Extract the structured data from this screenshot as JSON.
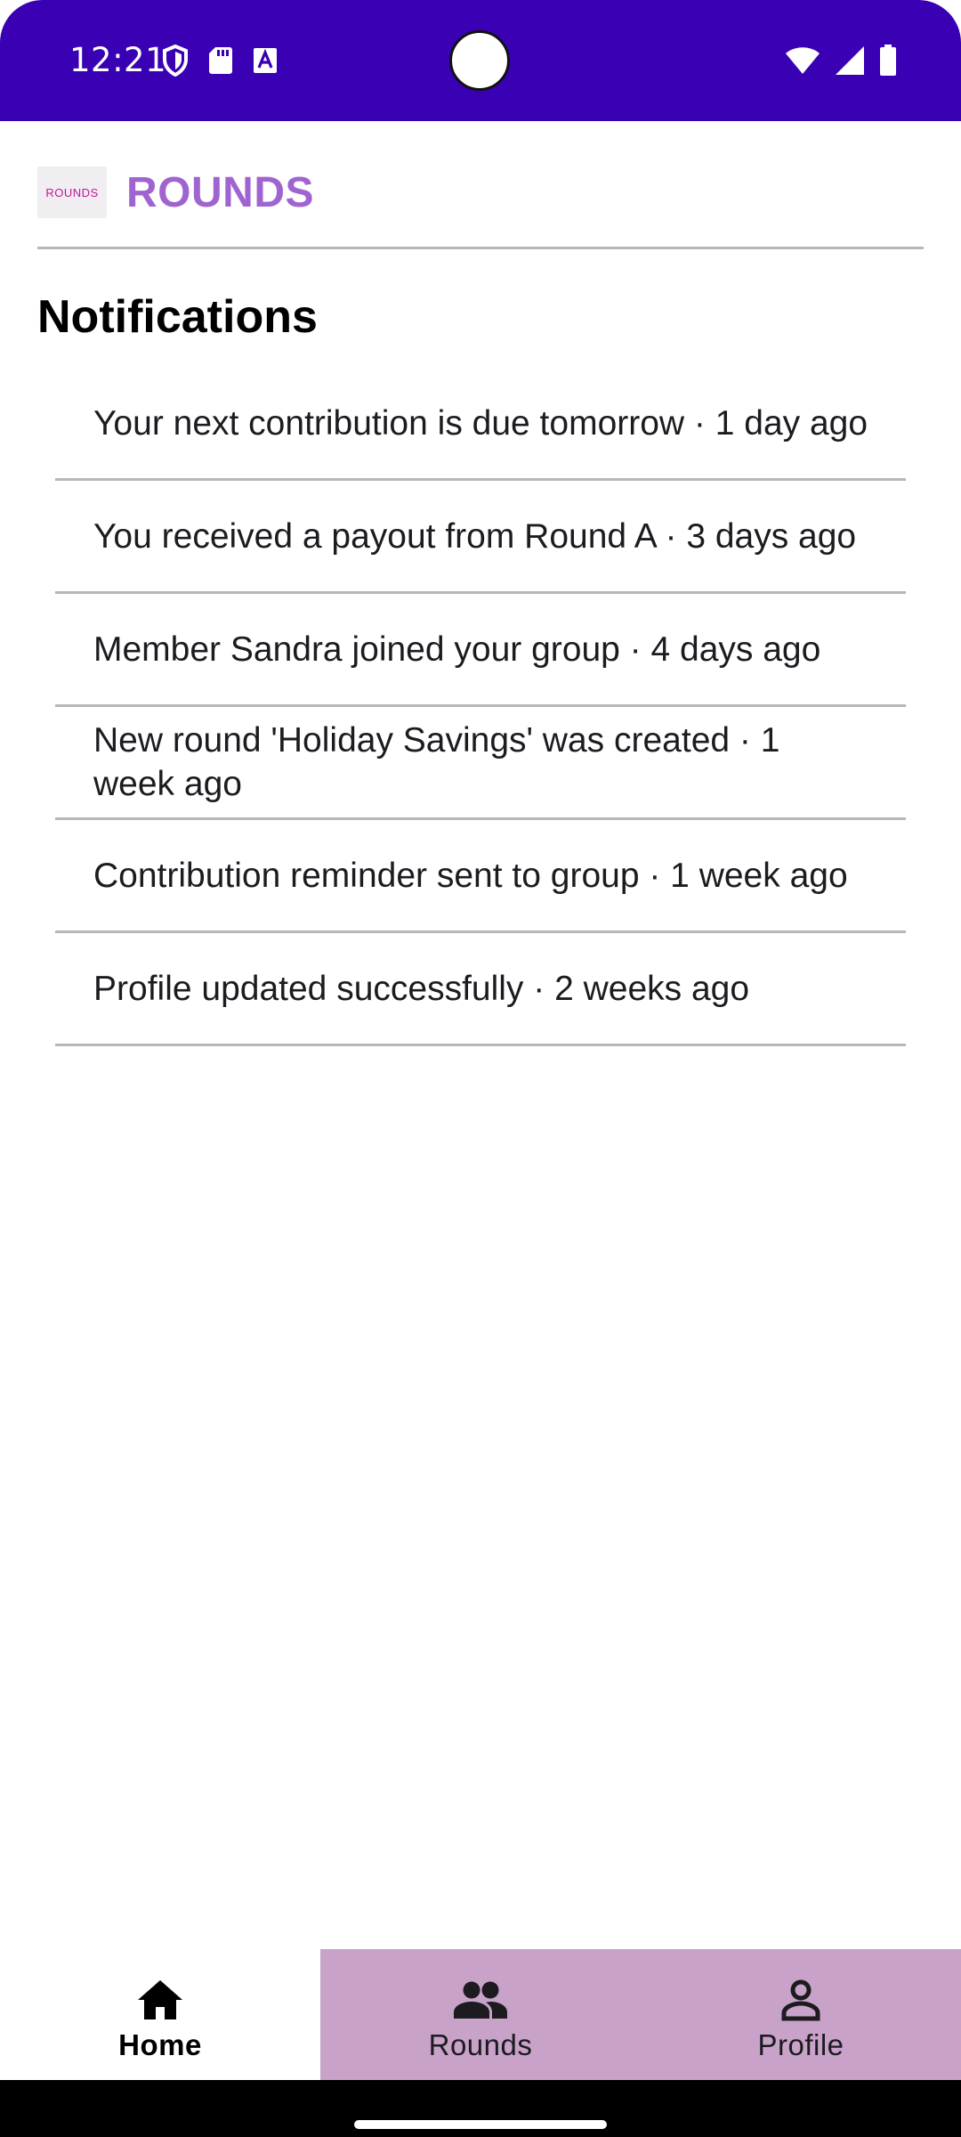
{
  "status_bar": {
    "time": "12:21",
    "icons": [
      "shield-icon",
      "sd-card-icon",
      "font-a-icon",
      "wifi-icon",
      "signal-icon",
      "battery-icon"
    ]
  },
  "header": {
    "logo_text": "ROUNDS",
    "title": "ROUNDS",
    "title_color": "#a064d0"
  },
  "notifications": {
    "title": "Notifications",
    "items": [
      "Your next contribution is due tomorrow · 1 day ago",
      "You received a payout from Round A · 3 days ago",
      "Member Sandra joined your group · 4 days ago",
      "New round 'Holiday Savings' was created · 1 week ago",
      "Contribution reminder sent to group · 1 week ago",
      "Profile updated successfully · 2 weeks ago"
    ]
  },
  "bottom_nav": {
    "active_color": "#ffffff",
    "inactive_color": "#c8a2c8",
    "tabs": [
      {
        "label": "Home",
        "icon": "home-icon",
        "active": true
      },
      {
        "label": "Rounds",
        "icon": "group-icon",
        "active": false
      },
      {
        "label": "Profile",
        "icon": "person-icon",
        "active": false
      }
    ]
  }
}
